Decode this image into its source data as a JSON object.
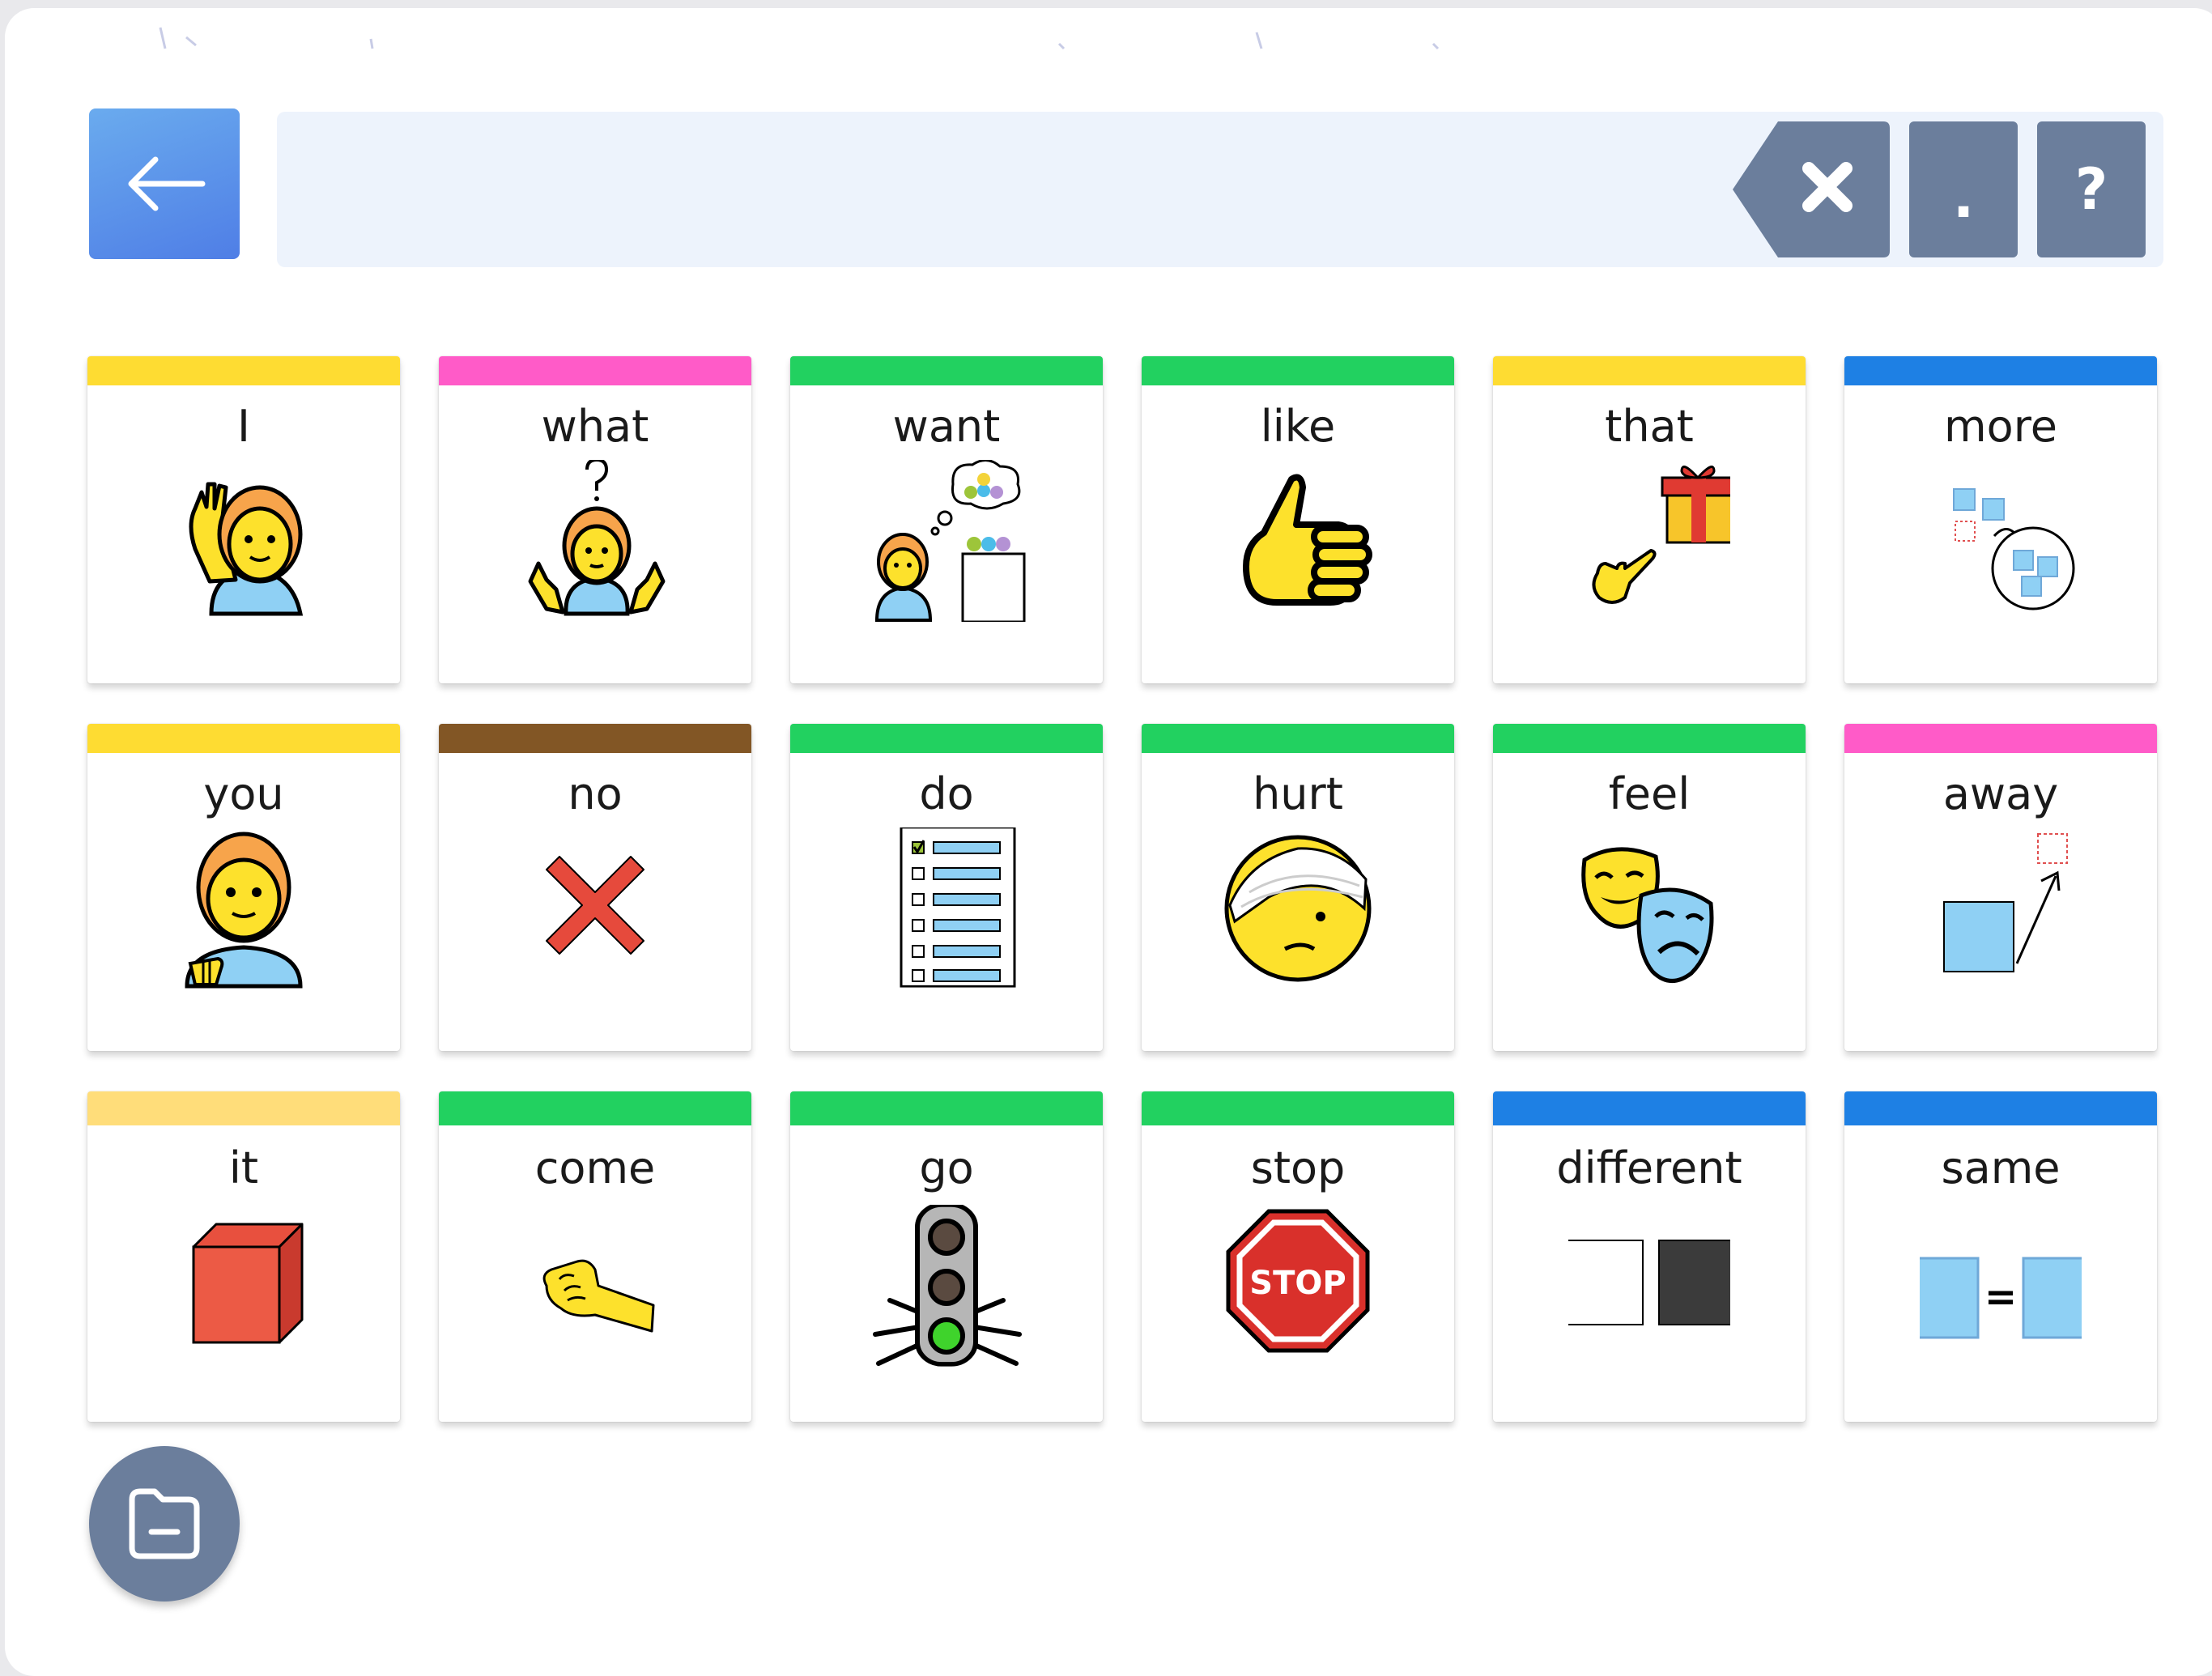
{
  "toolbar": {
    "back_icon": "arrow-left-icon",
    "clear_icon": "backspace-x-icon",
    "period_label": ".",
    "question_label": "?"
  },
  "message_bar": {
    "text": ""
  },
  "colors": {
    "yellow": "#fedc32",
    "pink": "#ff5bc8",
    "green": "#22d160",
    "blue": "#1e80e4",
    "brown": "#825625",
    "light_yellow": "#ffdd7a",
    "button_gray": "#6b7e9c"
  },
  "tiles": [
    {
      "label": "I",
      "color": "#fedc32",
      "icon": "person-raising-hand-icon"
    },
    {
      "label": "what",
      "color": "#ff5bc8",
      "icon": "person-shrugging-question-icon"
    },
    {
      "label": "want",
      "color": "#22d160",
      "icon": "person-thinking-want-icon"
    },
    {
      "label": "like",
      "color": "#22d160",
      "icon": "thumbs-up-icon"
    },
    {
      "label": "that",
      "color": "#fedc32",
      "icon": "pointing-at-gift-icon"
    },
    {
      "label": "more",
      "color": "#1e80e4",
      "icon": "more-squares-icon"
    },
    {
      "label": "you",
      "color": "#fedc32",
      "icon": "person-pointing-you-icon"
    },
    {
      "label": "no",
      "color": "#825625",
      "icon": "red-x-icon"
    },
    {
      "label": "do",
      "color": "#22d160",
      "icon": "checklist-icon"
    },
    {
      "label": "hurt",
      "color": "#22d160",
      "icon": "bandaged-face-icon"
    },
    {
      "label": "feel",
      "color": "#22d160",
      "icon": "theater-masks-icon"
    },
    {
      "label": "away",
      "color": "#ff5bc8",
      "icon": "square-moving-away-icon"
    },
    {
      "label": "it",
      "color": "#ffdd7a",
      "icon": "red-cube-icon"
    },
    {
      "label": "come",
      "color": "#22d160",
      "icon": "beckoning-hand-icon"
    },
    {
      "label": "go",
      "color": "#22d160",
      "icon": "green-traffic-light-icon"
    },
    {
      "label": "stop",
      "color": "#22d160",
      "icon": "stop-sign-icon",
      "sign_text": "STOP"
    },
    {
      "label": "different",
      "color": "#1e80e4",
      "icon": "white-black-squares-icon"
    },
    {
      "label": "same",
      "color": "#1e80e4",
      "icon": "equal-squares-icon",
      "sign_text": "="
    }
  ],
  "folder_button": {
    "icon": "folder-minus-icon"
  }
}
